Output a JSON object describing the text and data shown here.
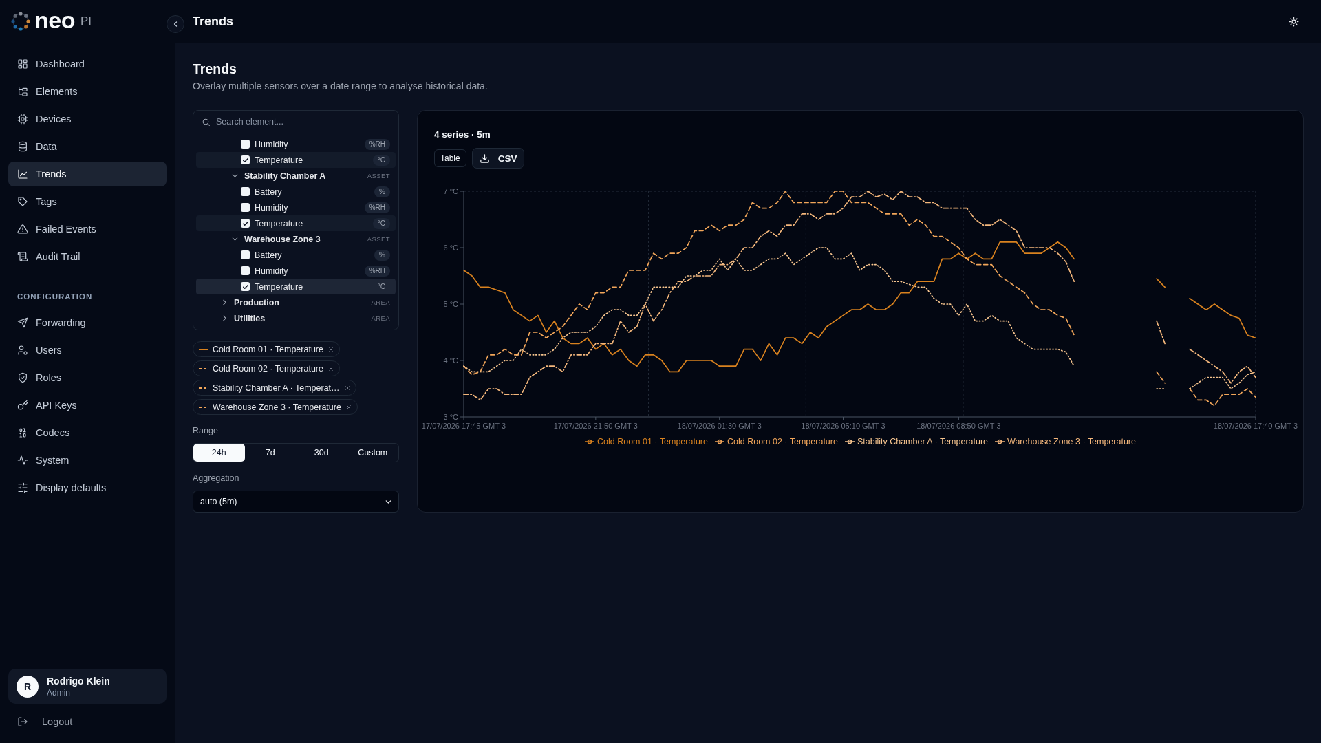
{
  "sidebar": {
    "logo": {
      "wordmark": "neo",
      "suffix": "PI"
    },
    "nav": [
      {
        "label": "Dashboard",
        "selected": false
      },
      {
        "label": "Elements",
        "selected": false
      },
      {
        "label": "Devices",
        "selected": false
      },
      {
        "label": "Data",
        "selected": false
      },
      {
        "label": "Trends",
        "selected": true
      },
      {
        "label": "Tags",
        "selected": false
      },
      {
        "label": "Failed Events",
        "selected": false
      },
      {
        "label": "Audit Trail",
        "selected": false
      }
    ],
    "configuration": {
      "heading": "CONFIGURATION",
      "items": [
        {
          "label": "Forwarding",
          "selected": false
        },
        {
          "label": "Users",
          "selected": false
        },
        {
          "label": "Roles",
          "selected": false
        },
        {
          "label": "API Keys",
          "selected": false
        },
        {
          "label": "Codecs",
          "selected": false
        },
        {
          "label": "System",
          "selected": false
        },
        {
          "label": "Display defaults",
          "selected": false
        }
      ]
    },
    "user": {
      "initial": "R",
      "name": "Rodrigo Klein",
      "role": "Admin"
    },
    "logout": "Logout"
  },
  "header": {
    "title": "Trends"
  },
  "page": {
    "title": "Trends",
    "subtitle": "Overlay multiple sensors over a date range to analyse historical data."
  },
  "element_picker": {
    "search": {
      "placeholder": "Search element..."
    },
    "tree": [
      {
        "kind": "continuation",
        "children": [
          {
            "kind": "continuation",
            "children": [
              {
                "kind": "sensor",
                "label": "Humidity",
                "unit": "%RH",
                "checked": false,
                "hovered": false
              },
              {
                "kind": "sensor",
                "label": "Temperature",
                "unit": "°C",
                "checked": true,
                "hovered": false
              }
            ]
          },
          {
            "kind": "node",
            "label": "Stability Chamber A",
            "tag": "ASSET",
            "expanded": true,
            "children": [
              {
                "kind": "sensor",
                "label": "Battery",
                "unit": "%",
                "checked": false,
                "hovered": false
              },
              {
                "kind": "sensor",
                "label": "Humidity",
                "unit": "%RH",
                "checked": false,
                "hovered": false
              },
              {
                "kind": "sensor",
                "label": "Temperature",
                "unit": "°C",
                "checked": true,
                "hovered": false
              }
            ]
          },
          {
            "kind": "node",
            "label": "Warehouse Zone 3",
            "tag": "ASSET",
            "expanded": true,
            "children": [
              {
                "kind": "sensor",
                "label": "Battery",
                "unit": "%",
                "checked": false,
                "hovered": false
              },
              {
                "kind": "sensor",
                "label": "Humidity",
                "unit": "%RH",
                "checked": false,
                "hovered": false
              },
              {
                "kind": "sensor",
                "label": "Temperature",
                "unit": "°C",
                "checked": true,
                "hovered": true
              }
            ]
          }
        ]
      },
      {
        "kind": "node",
        "label": "Production",
        "tag": "AREA",
        "expanded": false
      },
      {
        "kind": "node",
        "label": "Utilities",
        "tag": "AREA",
        "expanded": false
      }
    ],
    "selected_series": [
      {
        "label": "Cold Room 01 · Temperature",
        "color": "#d9821f",
        "dashed": false
      },
      {
        "label": "Cold Room 02 · Temperature",
        "color": "#f2a65a",
        "dashed": true
      },
      {
        "label": "Stability Chamber A · Temperat…",
        "color": "#f2a65a",
        "dashed": true
      },
      {
        "label": "Warehouse Zone 3 · Temperature",
        "color": "#f2a65a",
        "dashed": true
      }
    ],
    "range": {
      "label": "Range",
      "options": [
        {
          "label": "24h",
          "selected": true
        },
        {
          "label": "7d",
          "selected": false
        },
        {
          "label": "30d",
          "selected": false
        },
        {
          "label": "Custom",
          "selected": false
        }
      ]
    },
    "aggregation": {
      "label": "Aggregation",
      "value": "auto (5m)"
    }
  },
  "chart_panel": {
    "summary": "4 series · 5m",
    "buttons": [
      {
        "kind": "plain",
        "label": "Table"
      },
      {
        "kind": "download",
        "label": "CSV"
      }
    ],
    "chart_data": {
      "type": "line",
      "categories": [
        "17/07/2026 17:45 GMT-3",
        null,
        null,
        null,
        null,
        null,
        null,
        null,
        null,
        null,
        null,
        null,
        null,
        null,
        null,
        null,
        "17/07/2026 21:50 GMT-3",
        null,
        null,
        null,
        null,
        null,
        null,
        null,
        null,
        null,
        null,
        null,
        null,
        null,
        null,
        "18/07/2026 01:30 GMT-3",
        null,
        null,
        null,
        null,
        null,
        null,
        null,
        null,
        null,
        null,
        null,
        null,
        null,
        null,
        "18/07/2026 05:10 GMT-3",
        null,
        null,
        null,
        null,
        null,
        null,
        null,
        null,
        null,
        null,
        null,
        null,
        null,
        "18/07/2026 08:50 GMT-3",
        null,
        null,
        null,
        null,
        null,
        null,
        null,
        null,
        null,
        null,
        null,
        null,
        null,
        null,
        null,
        null,
        null,
        null,
        null,
        null,
        null,
        null,
        null,
        null,
        null,
        null,
        null,
        null,
        null,
        null,
        null,
        null,
        null,
        null,
        null,
        "18/07/2026 17:40 GMT-3"
      ],
      "series": [
        {
          "name": "Cold Room 01 · Temperature",
          "color": "#d9821f",
          "line_style": "solid",
          "values": [
            5.6,
            5.5,
            5.3,
            5.3,
            5.25,
            5.2,
            4.9,
            4.8,
            4.7,
            4.8,
            4.5,
            4.7,
            4.4,
            4.3,
            4.3,
            4.4,
            4.2,
            4.3,
            4.1,
            4.2,
            4.0,
            3.9,
            4.1,
            4.1,
            4.0,
            3.8,
            3.8,
            4.0,
            4.0,
            4.0,
            4.0,
            3.9,
            3.9,
            3.9,
            4.2,
            4.2,
            4.0,
            4.3,
            4.1,
            4.4,
            4.4,
            4.3,
            4.5,
            4.4,
            4.6,
            4.7,
            4.8,
            4.9,
            4.9,
            5.0,
            4.9,
            4.9,
            5.0,
            5.2,
            5.2,
            5.4,
            5.4,
            5.4,
            5.8,
            5.8,
            5.9,
            5.8,
            5.9,
            5.8,
            5.8,
            6.1,
            6.1,
            6.1,
            5.9,
            5.9,
            5.9,
            6.0,
            6.1,
            6.0,
            5.8,
            null,
            null,
            null,
            null,
            null,
            null,
            null,
            null,
            null,
            5.45,
            5.3,
            null,
            null,
            5.1,
            5.0,
            4.9,
            5.0,
            4.9,
            4.8,
            4.75,
            4.45,
            4.4
          ]
        },
        {
          "name": "Cold Room 02 · Temperature",
          "color": "#f2a65a",
          "line_style": "dashed",
          "values": [
            3.9,
            3.75,
            3.8,
            4.1,
            4.1,
            4.2,
            4.1,
            4.1,
            4.5,
            4.5,
            4.4,
            4.5,
            4.6,
            4.8,
            5.0,
            4.9,
            5.2,
            5.2,
            5.3,
            5.3,
            5.6,
            5.6,
            5.6,
            5.9,
            5.8,
            5.9,
            5.9,
            6.0,
            6.3,
            6.3,
            6.4,
            6.3,
            6.4,
            6.4,
            6.5,
            6.8,
            6.7,
            6.7,
            6.8,
            7.0,
            6.8,
            6.8,
            6.8,
            6.8,
            6.8,
            7.0,
            7.0,
            6.8,
            6.8,
            6.8,
            6.7,
            6.6,
            6.6,
            6.6,
            6.4,
            6.5,
            6.4,
            6.2,
            6.2,
            6.1,
            6.0,
            5.8,
            5.7,
            5.7,
            5.7,
            5.5,
            5.4,
            5.3,
            5.2,
            5.0,
            4.9,
            4.9,
            4.8,
            4.75,
            4.45,
            null,
            null,
            null,
            null,
            null,
            null,
            null,
            null,
            null,
            3.8,
            3.6,
            null,
            null,
            3.5,
            3.3,
            3.3,
            3.2,
            3.4,
            3.4,
            3.4,
            3.5,
            3.35
          ]
        },
        {
          "name": "Stability Chamber A · Temperature",
          "color": "#f7c58f",
          "line_style": "dotted",
          "values": [
            3.9,
            3.8,
            3.8,
            3.8,
            3.9,
            4.0,
            4.0,
            4.2,
            4.1,
            4.1,
            4.1,
            4.2,
            4.4,
            4.5,
            4.5,
            4.5,
            4.6,
            4.8,
            4.9,
            4.9,
            4.8,
            4.8,
            5.0,
            5.3,
            5.3,
            5.3,
            5.3,
            5.5,
            5.5,
            5.6,
            5.6,
            5.8,
            5.6,
            5.8,
            5.6,
            5.6,
            5.7,
            5.8,
            5.8,
            5.9,
            5.7,
            5.8,
            5.9,
            6.0,
            6.0,
            5.8,
            5.8,
            5.9,
            5.6,
            5.7,
            5.7,
            5.6,
            5.4,
            5.4,
            5.35,
            5.3,
            5.3,
            5.1,
            5.0,
            5.0,
            4.8,
            5.0,
            4.7,
            4.7,
            4.8,
            4.7,
            4.7,
            4.4,
            4.3,
            4.2,
            4.2,
            4.2,
            4.2,
            4.15,
            3.9,
            null,
            null,
            null,
            null,
            null,
            null,
            null,
            null,
            null,
            3.5,
            3.5,
            null,
            null,
            3.5,
            3.6,
            3.7,
            3.7,
            3.7,
            3.5,
            3.6,
            3.75,
            3.8
          ]
        },
        {
          "name": "Warehouse Zone 3 · Temperature",
          "color": "#f4b77c",
          "line_style": "dashdot",
          "values": [
            3.4,
            3.4,
            3.3,
            3.5,
            3.5,
            3.4,
            3.4,
            3.4,
            3.7,
            3.8,
            3.9,
            3.9,
            3.8,
            4.1,
            4.1,
            4.1,
            4.3,
            4.3,
            4.3,
            4.7,
            4.5,
            4.6,
            5.0,
            4.7,
            4.9,
            5.2,
            5.4,
            5.4,
            5.5,
            5.5,
            5.5,
            5.7,
            5.7,
            5.8,
            6.0,
            6.0,
            6.2,
            6.3,
            6.2,
            6.4,
            6.4,
            6.6,
            6.6,
            6.5,
            6.6,
            6.6,
            6.7,
            6.9,
            6.9,
            7.0,
            6.9,
            6.95,
            6.85,
            7.0,
            6.9,
            6.9,
            6.8,
            6.8,
            6.7,
            6.7,
            6.7,
            6.7,
            6.5,
            6.4,
            6.4,
            6.5,
            6.4,
            6.3,
            6.0,
            6.0,
            6.0,
            6.0,
            5.9,
            5.75,
            5.4,
            null,
            null,
            null,
            null,
            null,
            null,
            null,
            null,
            null,
            4.7,
            4.3,
            null,
            null,
            4.2,
            4.1,
            4.0,
            3.9,
            3.8,
            3.6,
            3.8,
            3.9,
            3.7
          ]
        }
      ],
      "ylim": [
        3,
        7
      ],
      "yticks": [
        {
          "value": 3,
          "label": "3 °C"
        },
        {
          "value": 4,
          "label": "4 °C"
        },
        {
          "value": 5,
          "label": "5 °C"
        },
        {
          "value": 6,
          "label": "6 °C"
        },
        {
          "value": 7,
          "label": "7 °C"
        }
      ],
      "legend": "bottom"
    }
  }
}
